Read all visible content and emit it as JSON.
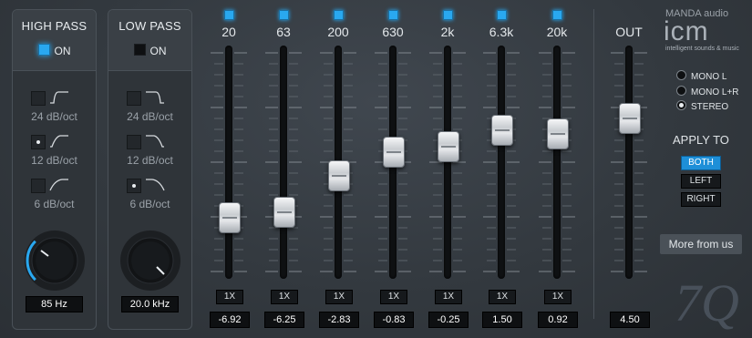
{
  "high_pass": {
    "title": "HIGH PASS",
    "on_label": "ON",
    "enabled": true,
    "slopes": [
      {
        "label": "24 dB/oct",
        "selected": false
      },
      {
        "label": "12 dB/oct",
        "selected": true
      },
      {
        "label": "6 dB/oct",
        "selected": false
      }
    ],
    "frequency": "85 Hz"
  },
  "low_pass": {
    "title": "LOW PASS",
    "on_label": "ON",
    "enabled": false,
    "slopes": [
      {
        "label": "24 dB/oct",
        "selected": false
      },
      {
        "label": "12 dB/oct",
        "selected": false
      },
      {
        "label": "6 dB/oct",
        "selected": true
      }
    ],
    "frequency": "20.0 kHz"
  },
  "bands": [
    {
      "label": "20",
      "multiplier": "1X",
      "gain": "-6.92",
      "level": 0.22
    },
    {
      "label": "63",
      "multiplier": "1X",
      "gain": "-6.25",
      "level": 0.25
    },
    {
      "label": "200",
      "multiplier": "1X",
      "gain": "-2.83",
      "level": 0.43
    },
    {
      "label": "630",
      "multiplier": "1X",
      "gain": "-0.83",
      "level": 0.55
    },
    {
      "label": "2k",
      "multiplier": "1X",
      "gain": "-0.25",
      "level": 0.58
    },
    {
      "label": "6.3k",
      "multiplier": "1X",
      "gain": "1.50",
      "level": 0.66
    },
    {
      "label": "20k",
      "multiplier": "1X",
      "gain": "0.92",
      "level": 0.64
    }
  ],
  "out": {
    "label": "OUT",
    "gain": "4.50",
    "level": 0.72
  },
  "modes": {
    "options": [
      "MONO L",
      "MONO L+R",
      "STEREO"
    ],
    "selected": "STEREO"
  },
  "apply_to": {
    "title": "APPLY TO",
    "options": [
      "BOTH",
      "LEFT",
      "RIGHT"
    ],
    "selected": "BOTH"
  },
  "more_button": "More from us",
  "brand": {
    "maker": "MANDA audio",
    "logo": "icm",
    "tagline": "intelligent sounds & music",
    "model": "7Q"
  },
  "colors": {
    "accent": "#29a8f0",
    "background": "#353b41"
  }
}
